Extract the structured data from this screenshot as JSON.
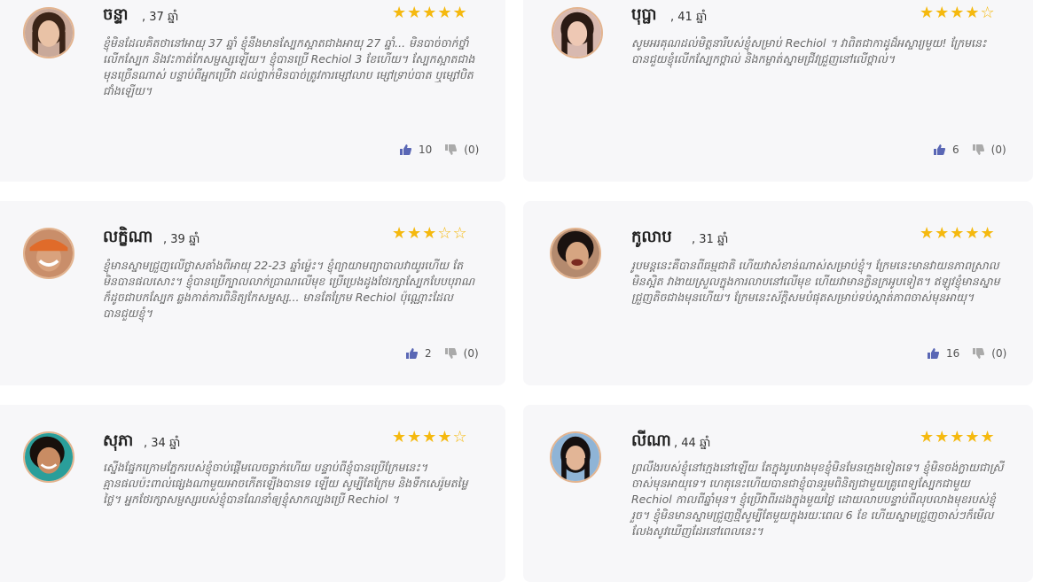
{
  "reviews": [
    {
      "name": "ចន្ទា",
      "age_text": ", 37 ឆ្នាំ",
      "rating": 5,
      "stars": "★★★★★",
      "text": "ខ្ញុំមិនដែលគិតថានៅអាយុ 37 ឆ្នាំ ខ្ញុំនឹងមានស្បែកស្អាតជាងអាយុ 27 ឆ្នាំ... មិនបាច់ចាក់ថ្នាំលើកស្បែក និងវះកាត់កែសម្ផស្សឡើយ។ ខ្ញុំបានប្រើ Rechiol 3 ខែហើយ។ ស្បែកស្អាតជាងមុនច្រើនណាស់ បន្ទាប់ពីអ្នកប្រើវា ដល់ថ្នាក់មិនបាច់ត្រូវការម្សៅលាប ម្សៅទ្រាប់បាត ឬម្សៅបិតជាំងឡើយ។",
      "likes": "10",
      "dislikes": "(0)",
      "avatar_skin": "#e9c2a6",
      "avatar_hair": "#3a2418",
      "avatar_bg": "#c9a99a"
    },
    {
      "name": "បុប្ផា",
      "age_text": ", 41 ឆ្នាំ",
      "rating": 4,
      "stars": "★★★★☆",
      "text": "សូមអរគុណដល់មិត្តនារីបស់ខ្ញុំសម្រាប់ Rechiol ។ វាពិតជាកាដូដ៏អស្ចារ្យមួយ! ក្រែមនេះបានជួយខ្ញុំលើកស្បែកថ្ពាល់ និងកម្ចាត់ស្នាមជ្រីវជ្រួញនៅលើថ្ពាល់។",
      "likes": "6",
      "dislikes": "(0)",
      "avatar_skin": "#eec8b4",
      "avatar_hair": "#2a1a14",
      "avatar_bg": "#d8b9b0"
    },
    {
      "name": "លក្ខិណា",
      "age_text": ", 39 ឆ្នាំ",
      "rating": 3,
      "stars": "★★★☆☆",
      "text": "ខ្ញុំមានស្នាមជ្រួញលើថ្ងាសតាំងពីអាយុ 22-23 ឆ្នាំម្ល៉េះ។ ខ្ញុំព្យាយាមព្យាបាលវាយូរហើយ តែមិនបានផលសោះ។ ខ្ញុំបានប្រើក្បាលលាក់ប្រាណលើមុខ ប្រើប្រេងដូងថែរក្សាស្បែកបែបបុរាណ ក៏ដូចជាបកស្បែក ឆ្លងកាត់ការពិនិត្យកែសម្ផស្ស... មានតែក្រែម Rechiol ប៉ុណ្ណោះដែលបានជួយខ្ញុំ។",
      "likes": "2",
      "dislikes": "(0)",
      "avatar_skin": "#d9a27d",
      "avatar_hair": "#e06b2a",
      "avatar_bg": "#c98e6a"
    },
    {
      "name": "កូលាប",
      "age_text": ", 31 ឆ្នាំ",
      "rating": 5,
      "stars": "★★★★★",
      "text": "រូបមន្តនេះគឺបានពីធម្មជាតិ ហើយវាសំខាន់ណាស់សម្រាប់ខ្ញុំ។ ក្រែមនេះមានវាយនភាពស្រាល មិនស្អិត វាងាយស្រួលក្នុងការលាបនៅលើមុខ ហើយវាមានក្លិនក្រអូបទៀត។ ឥឡូវខ្ញុំមានស្នាមជ្រួញតិចជាងមុនហើយ។ ក្រែមនេះស័ក្តិសមបំផុតសម្រាប់ទប់ស្កាត់ភាពចាស់មុនអាយុ។",
      "likes": "16",
      "dislikes": "(0)",
      "avatar_skin": "#d6a581",
      "avatar_hair": "#1a1210",
      "avatar_bg": "#b48a6e"
    },
    {
      "name": "សុភា",
      "age_text": ", 34 ឆ្នាំ",
      "rating": 4,
      "stars": "★★★★☆",
      "text": "ស្នើងផ្នែកក្រោមភ្នែករបស់ខ្ញុំចាប់ផ្តើមលេចធ្លាក់ហើយ បន្ទាប់ពីខ្ញុំបានប្រើក្រែមនេះ។ គ្មានផលប៉ះពាល់ផ្សេងណាមួយអាចកើតឡើងបានទេ ឡើយ សូម្បីតែក្រែម និងទឹកសេរ៉ូមតម្លៃថ្លៃ។ អ្នកថែរក្សាសម្ផស្សរបស់ខ្ញុំបានណែនាំឲ្យខ្ញុំសាកល្បងប្រើ Rechiol ។",
      "likes": "",
      "dislikes": "",
      "avatar_skin": "#c98c63",
      "avatar_hair": "#18100c",
      "avatar_bg": "#2a9e9a"
    },
    {
      "name": "លីណា",
      "age_text": ", 44 ឆ្នាំ",
      "rating": 5,
      "stars": "★★★★★",
      "text": "ព្រលឹងរបស់ខ្ញុំនៅក្មេងនៅឡើយ តែក្នុងរូបរាងមុខខ្ញុំមិនមែនក្មេងទៀតទេ។ ខ្ញុំមិនចង់ក្លាយជាស្រីចាស់មុនអាយុទេ។ ហេតុនេះហើយបានជាខ្ញុំបានរួមពិនិត្យជាមួយគ្រូពេទ្យស្បែកជាមួយ Rechiol កាលពីឆ្នាំមុន។ ខ្ញុំប្រើវាពីរដងក្នុងមួយថ្ងៃ ដោយលាបបន្ទាប់ពីលុបលាងមុខរបស់ខ្ញុំរួច។ ខ្ញុំមិនមានស្នាមជ្រួញថ្មីសូម្បីតែមួយក្នុងរយៈពេល 6 ខែ ហើយស្នាមជ្រួញចាស់ៗក៏មើលលែងសូវឃើញដែរនៅពេលនេះ។",
      "likes": "",
      "dislikes": "",
      "avatar_skin": "#e2b596",
      "avatar_hair": "#151010",
      "avatar_bg": "#8fb4d6"
    }
  ]
}
